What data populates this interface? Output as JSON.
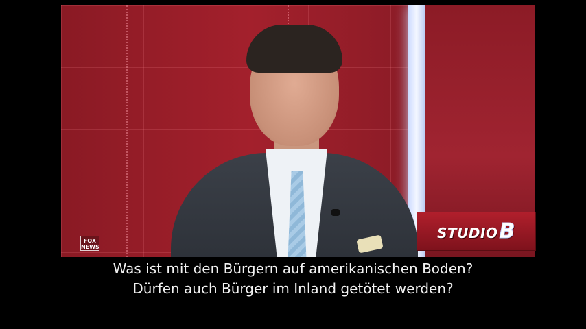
{
  "broadcast": {
    "network_logo": {
      "line1": "FOX",
      "line2": "NEWS"
    },
    "show_badge": {
      "text": "STUDIO",
      "letter": "B"
    }
  },
  "subtitles": [
    "Was ist mit den Bürgern auf amerikanischen Boden?",
    "Dürfen auch Bürger im Inland getötet werden?"
  ],
  "colors": {
    "studio_background": "#a3202c",
    "subtitle_text": "#f2f2f2",
    "letterbox": "#000000"
  }
}
